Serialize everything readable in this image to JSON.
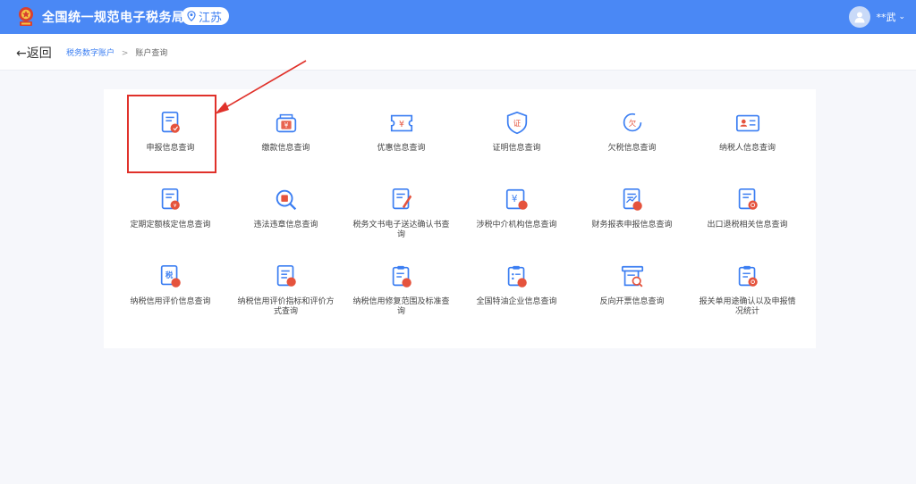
{
  "header": {
    "site_title": "全国统一规范电子税务局",
    "region": "江苏",
    "username": "**武",
    "caret": "⌄"
  },
  "breadcrumb": {
    "back_label": "←返回",
    "items": [
      "税务数字账户",
      "账户查询"
    ],
    "separator": ">"
  },
  "colors": {
    "header_bg": "#4a88f5",
    "accent": "#3b7ef2",
    "icon_red": "#e5533d",
    "highlight_red": "#e0312a"
  },
  "tiles": [
    {
      "label": "申报信息查询",
      "icon": "declaration-icon",
      "highlight": true
    },
    {
      "label": "缴款信息查询",
      "icon": "payment-icon"
    },
    {
      "label": "优惠信息查询",
      "icon": "discount-icon"
    },
    {
      "label": "证明信息查询",
      "icon": "certificate-icon"
    },
    {
      "label": "欠税信息查询",
      "icon": "arrears-icon"
    },
    {
      "label": "纳税人信息查询",
      "icon": "taxpayer-card-icon"
    },
    {
      "label": "定期定额核定信息查询",
      "icon": "fixed-quota-icon"
    },
    {
      "label": "违法违章信息查询",
      "icon": "violation-search-icon"
    },
    {
      "label": "税务文书电子送达确认书查询",
      "icon": "document-edit-icon"
    },
    {
      "label": "涉税中介机构信息查询",
      "icon": "agency-icon"
    },
    {
      "label": "财务报表申报信息查询",
      "icon": "financial-report-icon"
    },
    {
      "label": "出口退税相关信息查询",
      "icon": "export-refund-icon"
    },
    {
      "label": "纳税信用评价信息查询",
      "icon": "credit-rating-icon"
    },
    {
      "label": "纳税信用评价指标和评价方式查询",
      "icon": "credit-index-icon"
    },
    {
      "label": "纳税信用修复范围及标准查询",
      "icon": "credit-repair-icon"
    },
    {
      "label": "全国特油企业信息查询",
      "icon": "oil-enterprise-icon"
    },
    {
      "label": "反向开票信息查询",
      "icon": "reverse-invoice-icon"
    },
    {
      "label": "报关单用途确认以及申报情况统计",
      "icon": "customs-declaration-icon"
    }
  ]
}
